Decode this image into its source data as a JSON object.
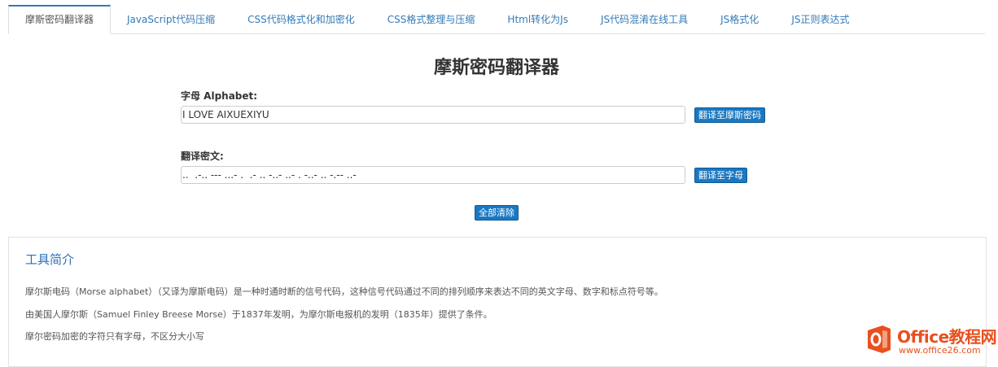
{
  "tabs": [
    {
      "label": "摩斯密码翻译器",
      "active": true
    },
    {
      "label": "JavaScript代码压缩",
      "active": false
    },
    {
      "label": "CSS代码格式化和加密化",
      "active": false
    },
    {
      "label": "CSS格式整理与压缩",
      "active": false
    },
    {
      "label": "Html转化为Js",
      "active": false
    },
    {
      "label": "JS代码混淆在线工具",
      "active": false
    },
    {
      "label": "JS格式化",
      "active": false
    },
    {
      "label": "JS正则表达式",
      "active": false
    }
  ],
  "translator": {
    "title": "摩斯密码翻译器",
    "alphabet_label": "字母 Alphabet:",
    "alphabet_value": "I LOVE AIXUEXIYU",
    "to_morse_button": "翻译至摩斯密码",
    "cipher_label": "翻译密文:",
    "cipher_value": "..  .-.. --- ...- .  .- .. -..- ..- . -..- .. -.-- ..-",
    "to_alpha_button": "翻译至字母",
    "clear_button": "全部清除"
  },
  "intro": {
    "title": "工具简介",
    "paragraphs": [
      "摩尔斯电码（Morse alphabet）（又译为摩斯电码）是一种时通时断的信号代码，这种信号代码通过不同的排列顺序来表达不同的英文字母、数字和标点符号等。",
      "由美国人摩尔斯（Samuel Finley Breese Morse）于1837年发明，为摩尔斯电报机的发明（1835年）提供了条件。",
      "摩尔密码加密的字符只有字母，不区分大小写"
    ]
  },
  "watermark": {
    "name": "Office教程网",
    "url": "www.office26.com",
    "color": "#e8501e"
  }
}
